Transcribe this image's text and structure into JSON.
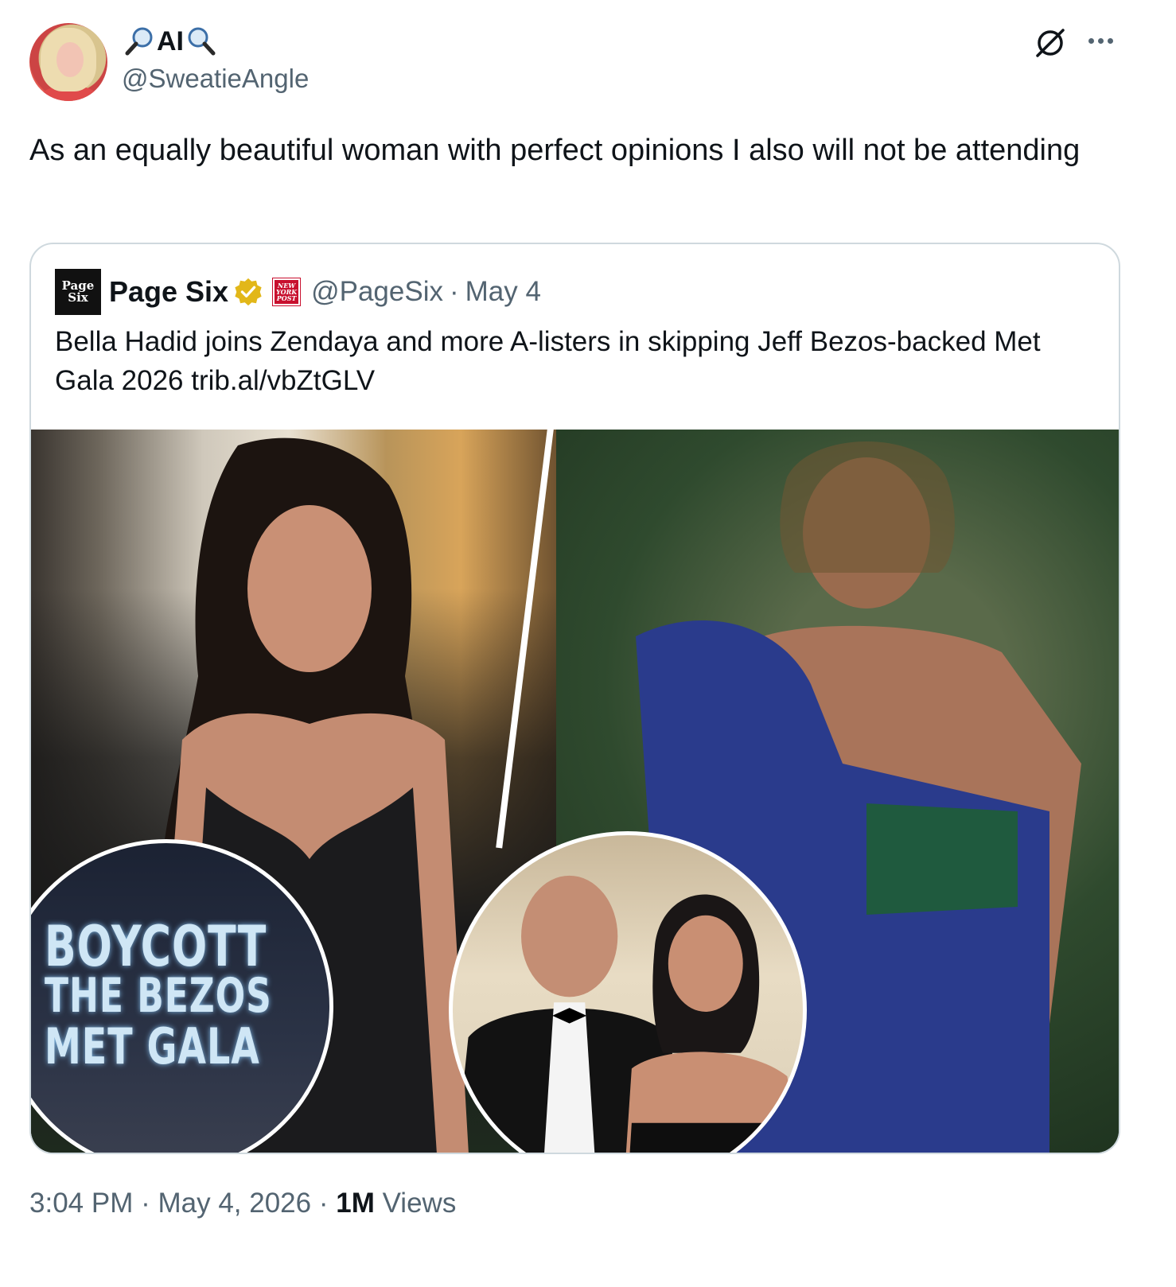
{
  "author": {
    "display_name": "AI",
    "handle": "@SweatieAngle"
  },
  "tweet": {
    "text": "As an equally beautiful woman with perfect opinions I also will not be attending",
    "time": "3:04 PM",
    "separator": "·",
    "date": "May 4, 2026",
    "views_count": "1M",
    "views_label": "Views"
  },
  "quote": {
    "name": "Page Six",
    "handle": "@PageSix",
    "separator": "·",
    "date": "May 4",
    "text": "Bella Hadid joins Zendaya and more A-listers in skipping Jeff Bezos-backed Met Gala 2026 trib.al/vbZtGLV",
    "logo_text_1": "Page",
    "logo_text_2": "Six",
    "affiliate_text_1": "NEW",
    "affiliate_text_2": "YORK",
    "affiliate_text_3": "POST",
    "media": {
      "boycott_line_1": "BOYCOTT",
      "boycott_line_2": "THE BEZOS",
      "boycott_line_3": "MET GALA"
    }
  },
  "colors": {
    "text": "#0f1419",
    "secondary": "#536471",
    "border": "#cfd9de",
    "verified_gold": "#e2b719",
    "nyp_red": "#c8102e"
  },
  "icons": [
    "magnifier-icon",
    "grok-icon",
    "more-icon",
    "verified-badge-icon"
  ]
}
